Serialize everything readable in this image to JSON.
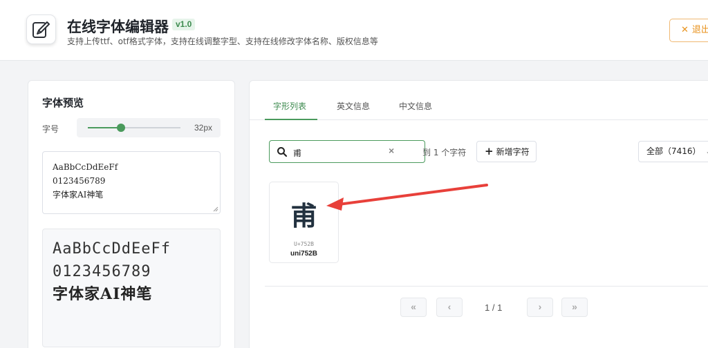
{
  "header": {
    "title": "在线字体编辑器",
    "version": "v1.0",
    "subtitle": "支持上传ttf、otf格式字体，支持在线调整字型、支持在线修改字体名称、版权信息等",
    "logout_label": "退出"
  },
  "preview": {
    "title": "字体预览",
    "size_label": "字号",
    "size_value": "32px",
    "size_fraction": 0.36,
    "input_lines": [
      "AaBbCcDdEeFf",
      "0123456789",
      "字体家AI神笔"
    ],
    "output_lines": [
      "AaBbCcDdEeFf",
      "0123456789",
      "字体家AI神笔"
    ]
  },
  "tabs": [
    {
      "label": "字形列表",
      "active": true
    },
    {
      "label": "英文信息",
      "active": false
    },
    {
      "label": "中文信息",
      "active": false
    }
  ],
  "search": {
    "value": "甫",
    "result_text": "到 1 个字符"
  },
  "toolbar": {
    "add_label": "新增字符",
    "filter_label": "全部（7416）"
  },
  "glyphs": [
    {
      "char": "甫",
      "code": "U+752B",
      "name": "uni752B"
    }
  ],
  "pager": {
    "first": "«",
    "prev": "‹",
    "text": "1 / 1",
    "next": "›",
    "last": "»"
  },
  "colors": {
    "accent": "#4a9a5c",
    "logout": "#e8921c",
    "annotation_arrow": "#e8403a"
  }
}
